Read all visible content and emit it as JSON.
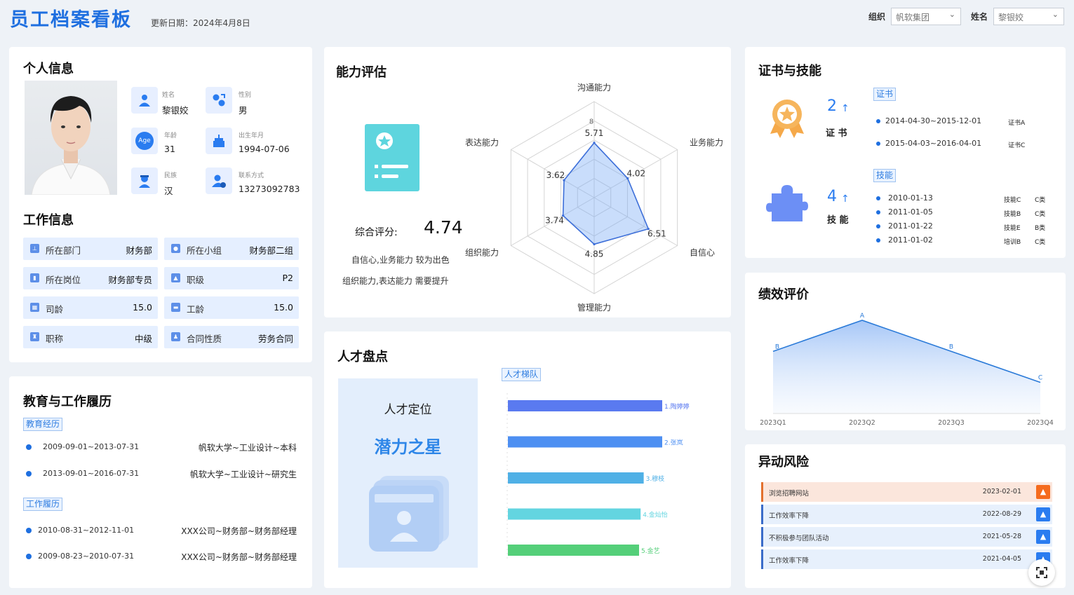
{
  "header": {
    "title": "员工档案看板",
    "update_date": "更新日期：2024年4月8日",
    "org_label": "组织",
    "org_value": "帆软集团",
    "name_label": "姓名",
    "name_value": "黎银姣"
  },
  "personal": {
    "title": "个人信息",
    "fields": [
      {
        "label": "姓名",
        "value": "黎银姣"
      },
      {
        "label": "性别",
        "value": "男"
      },
      {
        "label": "年龄",
        "value": "31"
      },
      {
        "label": "出生年月",
        "value": "1994-07-06"
      },
      {
        "label": "民族",
        "value": "汉"
      },
      {
        "label": "联系方式",
        "value": "13273092783"
      }
    ],
    "age_icon_text": "Age"
  },
  "work": {
    "title": "工作信息",
    "items": [
      {
        "label": "所在部门",
        "value": "财务部"
      },
      {
        "label": "所在小组",
        "value": "财务部二组"
      },
      {
        "label": "所在岗位",
        "value": "财务部专员"
      },
      {
        "label": "职级",
        "value": "P2"
      },
      {
        "label": "司龄",
        "value": "15.0"
      },
      {
        "label": "工龄",
        "value": "15.0"
      },
      {
        "label": "职称",
        "value": "中级"
      },
      {
        "label": "合同性质",
        "value": "劳务合同"
      }
    ]
  },
  "history": {
    "title": "教育与工作履历",
    "edu_tag": "教育经历",
    "edu": [
      {
        "date": "2009-09-01~2013-07-31",
        "desc": "帆软大学~工业设计~本科"
      },
      {
        "date": "2013-09-01~2016-07-31",
        "desc": "帆软大学~工业设计~研究生"
      }
    ],
    "work_tag": "工作履历",
    "work": [
      {
        "date": "2010-08-31~2012-11-01",
        "desc": "XXX公司~财务部~财务部经理"
      },
      {
        "date": "2009-08-23~2010-07-31",
        "desc": "XXX公司~财务部~财务部经理"
      }
    ]
  },
  "ability": {
    "title": "能力评估",
    "score_label": "综合评分:",
    "score": "4.74",
    "note1": "自信心,业务能力 较为出色",
    "note2": "组织能力,表达能力 需要提升"
  },
  "chart_data": {
    "type": "radar",
    "axes": [
      "沟通能力",
      "业务能力",
      "自信心",
      "管理能力",
      "组织能力",
      "表达能力"
    ],
    "values": [
      5.71,
      4.02,
      6.51,
      4.85,
      3.74,
      3.62
    ],
    "max": 10,
    "tick_labels": [
      "8"
    ],
    "color": "#3d6fd9"
  },
  "talent": {
    "title": "人才盘点",
    "position_label": "人才定位",
    "position_value": "潜力之星",
    "ladder_tag": "人才梯队",
    "ladder": [
      {
        "name": "1.陶婷婷",
        "value": 100,
        "color": "#5a7af0"
      },
      {
        "name": "2.张岚",
        "value": 100,
        "color": "#4d8ff2"
      },
      {
        "name": "3.穆枝",
        "value": 88,
        "color": "#4fb0e6"
      },
      {
        "name": "4.金灿怡",
        "value": 86,
        "color": "#63d5e0"
      },
      {
        "name": "5.金艺",
        "value": 85,
        "color": "#54cf79"
      }
    ]
  },
  "certs": {
    "title": "证书与技能",
    "cert_count": "2",
    "cert_label": "证 书",
    "cert_tag": "证书",
    "cert_list": [
      {
        "date": "2014-04-30~2015-12-01",
        "name": "证书A"
      },
      {
        "date": "2015-04-03~2016-04-01",
        "name": "证书C"
      }
    ],
    "skill_count": "4",
    "skill_label": "技 能",
    "skill_tag": "技能",
    "skill_list": [
      {
        "date": "2010-01-13",
        "name": "技能C",
        "level": "C类"
      },
      {
        "date": "2011-01-05",
        "name": "技能B",
        "level": "C类"
      },
      {
        "date": "2011-01-22",
        "name": "技能E",
        "level": "B类"
      },
      {
        "date": "2011-01-02",
        "name": "培训B",
        "level": "C类"
      }
    ],
    "arrow": "↑"
  },
  "performance": {
    "title": "绩效评价",
    "chart": {
      "type": "area",
      "x": [
        "2023Q1",
        "2023Q2",
        "2023Q3",
        "2023Q4"
      ],
      "labels": [
        "B",
        "A",
        "B",
        "C"
      ],
      "values": [
        3,
        4,
        3,
        2
      ]
    }
  },
  "risk": {
    "title": "异动风险",
    "items": [
      {
        "text": "浏览招聘网站",
        "date": "2023-02-01",
        "level": "high"
      },
      {
        "text": "工作效率下降",
        "date": "2022-08-29",
        "level": "normal"
      },
      {
        "text": "不积极参与团队活动",
        "date": "2021-05-28",
        "level": "normal"
      },
      {
        "text": "工作效率下降",
        "date": "2021-04-05",
        "level": "normal"
      }
    ]
  }
}
